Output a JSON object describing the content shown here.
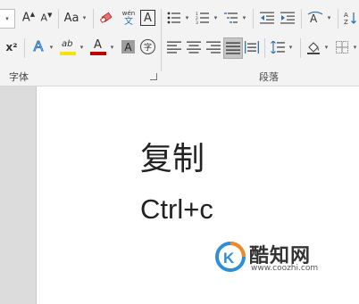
{
  "ribbon": {
    "row1": {
      "grow_font": "A",
      "shrink_font": "A",
      "change_case": "Aa",
      "phonetic_guide_top": "wén",
      "phonetic_guide_bottom": "文",
      "char_border": "A"
    },
    "row2": {
      "superscript": "x²",
      "text_effect": "A",
      "highlight": "ab",
      "font_color": "A",
      "char_shading": "A",
      "enclose_char": "字"
    },
    "groups": {
      "font_label": "字体",
      "paragraph_label": "段落"
    },
    "colors": {
      "highlight": "#f5e40c",
      "font_color": "#c00000",
      "effect_color": "#2e75b6"
    }
  },
  "document": {
    "title": "复制",
    "shortcut": "Ctrl+c"
  },
  "watermark": {
    "name": "酷知网",
    "url": "www.coozhi.com"
  }
}
